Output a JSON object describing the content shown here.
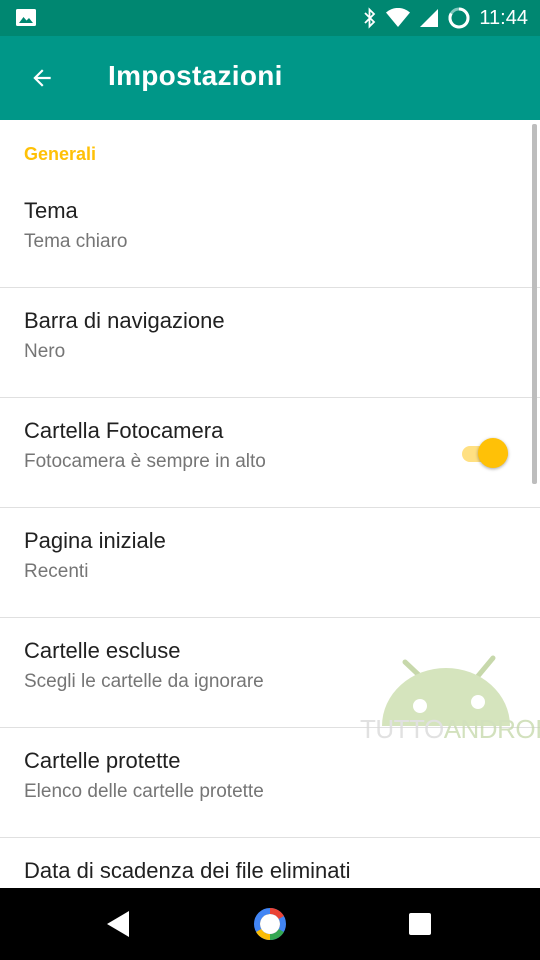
{
  "status_bar": {
    "time": "11:44",
    "icons": [
      "image-icon",
      "bluetooth-icon",
      "wifi-icon",
      "signal-icon",
      "battery-icon"
    ]
  },
  "app_bar": {
    "title": "Impostazioni",
    "back_icon": "arrow-back-icon"
  },
  "settings": {
    "section_header": "Generali",
    "items": [
      {
        "title": "Tema",
        "summary": "Tema chiaro"
      },
      {
        "title": "Barra di navigazione",
        "summary": "Nero"
      },
      {
        "title": "Cartella Fotocamera",
        "summary": "Fotocamera è sempre in alto",
        "toggle_on": true
      },
      {
        "title": "Pagina iniziale",
        "summary": "Recenti"
      },
      {
        "title": "Cartelle escluse",
        "summary": "Scegli le cartelle da ignorare"
      },
      {
        "title": "Cartelle protette",
        "summary": "Elenco delle cartelle protette"
      },
      {
        "title": "Data di scadenza dei file eliminati",
        "summary": ""
      }
    ]
  },
  "watermark": {
    "part1": "TUTTO",
    "part2": "ANDROID"
  },
  "nav_bar": {
    "icons": [
      "back-triangle-icon",
      "home-circle-icon",
      "recents-square-icon"
    ]
  },
  "colors": {
    "status_bar": "#008771",
    "app_bar": "#009788",
    "accent": "#FFC107",
    "title_text": "#212121",
    "summary_text": "#757575"
  }
}
